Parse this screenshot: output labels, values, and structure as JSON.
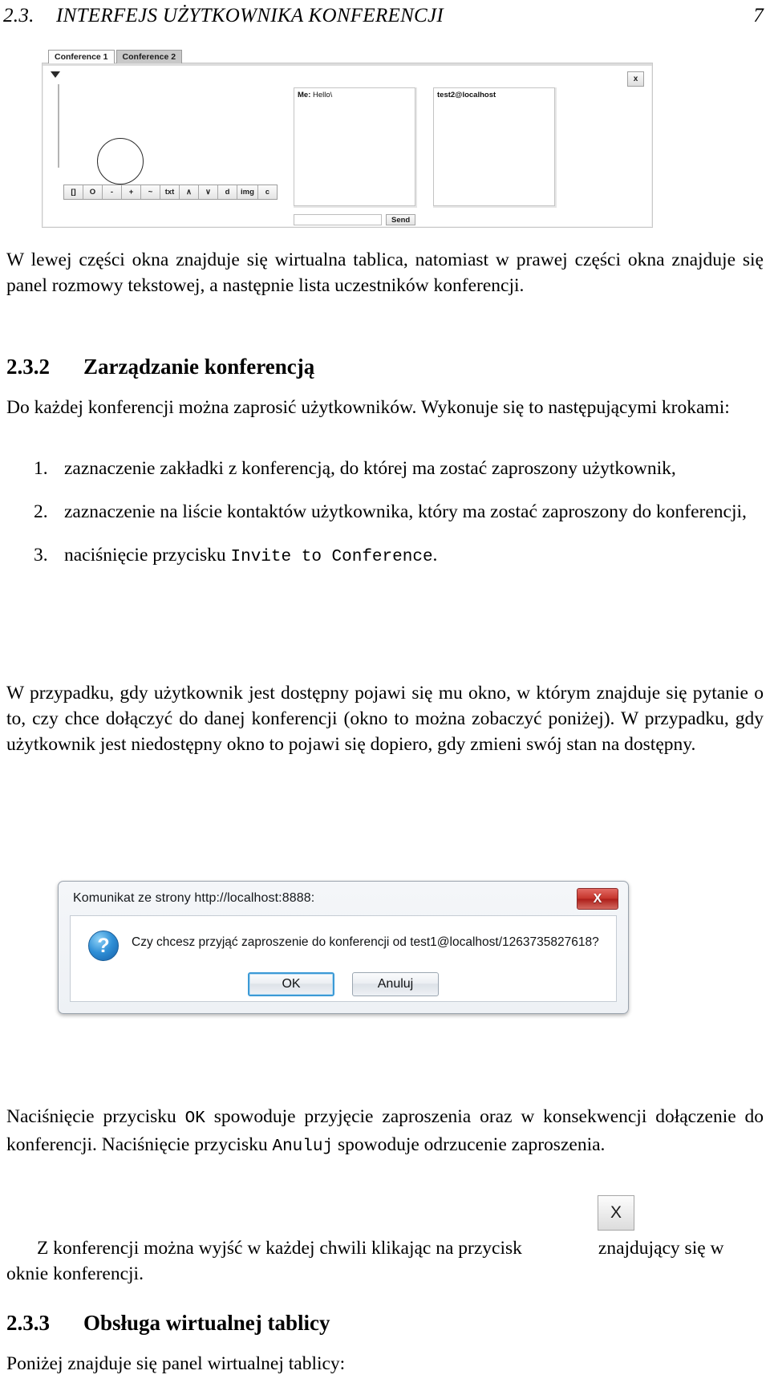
{
  "header": {
    "section_number": "2.3.",
    "title": "INTERFEJS UŻYTKOWNIKA KONFERENCJI",
    "page_number": "7"
  },
  "conference_window": {
    "tabs": [
      {
        "label": "Conference 1",
        "active": false
      },
      {
        "label": "Conference 2",
        "active": true
      }
    ],
    "whiteboard": {
      "toolbar_buttons": [
        "[]",
        "O",
        "-",
        "+",
        "~",
        "txt",
        "∧",
        "∨",
        "d",
        "img",
        "c"
      ]
    },
    "chat": {
      "message_author": "Me:",
      "message_text": "Hello\\",
      "input_value": "",
      "send_label": "Send"
    },
    "participants": {
      "items": [
        "test2@localhost"
      ]
    },
    "close_label": "x"
  },
  "body": {
    "intro_paragraph": "W lewej części okna znajduje się wirtualna tablica, natomiast w prawej części okna znajduje się panel rozmowy tekstowej, a następnie lista uczestników konferencji.",
    "section_2_3_2": {
      "number": "2.3.2",
      "title": "Zarządzanie konferencją"
    },
    "manage_intro": "Do każdej konferencji można zaprosić użytkowników. Wykonuje się to następującymi krokami:",
    "steps": [
      {
        "number": "1.",
        "text": "zaznaczenie zakładki z konferencją, do której ma zostać zaproszony użytkownik,"
      },
      {
        "number": "2.",
        "text": "zaznaczenie na liście kontaktów użytkownika, który ma zostać zaproszony do konferencji,"
      },
      {
        "number": "3.",
        "prefix": "naciśnięcie przycisku ",
        "mono": "Invite to Conference",
        "suffix": "."
      }
    ],
    "availability_paragraph": "W przypadku, gdy użytkownik jest dostępny pojawi się mu okno, w którym znajduje się pytanie o to, czy chce dołączyć do danej konferencji (okno to można zobaczyć poniżej). W przypadku, gdy użytkownik jest niedostępny okno to pojawi się dopiero, gdy zmieni swój stan na dostępny.",
    "ok_paragraph": {
      "p1": "Naciśnięcie przycisku ",
      "mono1": "OK",
      "p2": " spowoduje przyjęcie zaproszenia oraz w konsekwencji dołączenie do konferencji. Naciśnięcie przycisku ",
      "mono2": "Anuluj",
      "p3": " spowoduje odrzucenie zaproszenia."
    },
    "exit_paragraph": {
      "p1": "Z konferencji można wyjść w każdej chwili klikając na przycisk",
      "button_label": "X",
      "p2": "znajdujący się w oknie konferencji."
    },
    "section_2_3_3": {
      "number": "2.3.3",
      "title": "Obsługa wirtualnej tablicy"
    },
    "whiteboard_intro": "Poniżej znajduje się panel wirtualnej tablicy:"
  },
  "dialog": {
    "title": "Komunikat ze strony http://localhost:8888:",
    "close_label": "X",
    "icon": "?",
    "message": "Czy chcesz przyjąć zaproszenie do konferencji od test1@localhost/1263735827618?",
    "buttons": [
      {
        "label": "OK",
        "focused": true
      },
      {
        "label": "Anuluj",
        "focused": false
      }
    ]
  },
  "colors": {
    "dialog_close_red": "#c5352c",
    "focus_blue": "#3c9ad6",
    "active_tab_gray": "#c8c8c8"
  }
}
